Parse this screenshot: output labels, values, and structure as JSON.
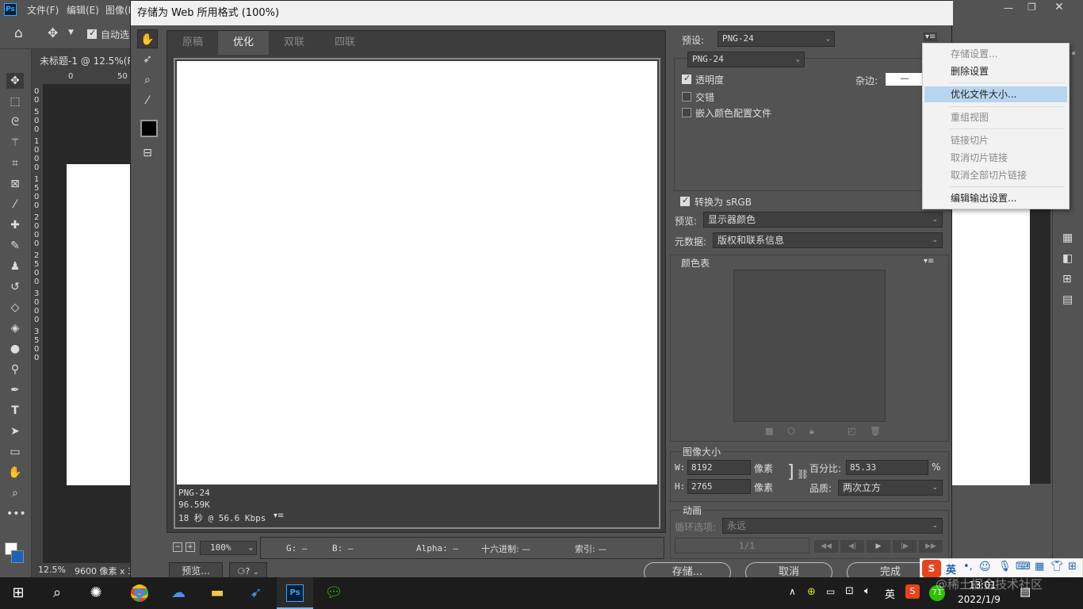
{
  "ps": {
    "menu": [
      "文件(F)",
      "编辑(E)",
      "图像(I"
    ],
    "auto_select": "自动选",
    "doc_tab": "未标题-1 @ 12.5%(R",
    "zoom": "12.5%",
    "doc_size": "9600 像素 x 3",
    "ruler_h": [
      "0",
      "50"
    ],
    "ruler_v": [
      "0",
      "0",
      "5",
      "0",
      "0",
      "1",
      "0",
      "0",
      "0",
      "1",
      "5",
      "0",
      "0",
      "2",
      "0",
      "0",
      "0",
      "2",
      "5",
      "0",
      "0",
      "3",
      "0",
      "0",
      "0",
      "3",
      "5",
      "0",
      "0"
    ]
  },
  "dialog": {
    "title": "存储为 Web 所用格式 (100%)",
    "tabs": [
      "原稿",
      "优化",
      "双联",
      "四联"
    ],
    "active_tab": "优化",
    "info": {
      "format": "PNG-24",
      "size": "96.59K",
      "time": "18 秒 @ 56.6 Kbps"
    },
    "zoom_value": "100%",
    "pixel_info": {
      "g": "G: —",
      "b": "B: —",
      "alpha": "Alpha: —",
      "hex": "十六进制: —",
      "index": "索引: —"
    },
    "preview_button": "预览...",
    "save_button": "存储...",
    "cancel_button": "取消",
    "done_button": "完成"
  },
  "settings": {
    "preset_label": "预设:",
    "preset_value": "PNG-24",
    "format_value": "PNG-24",
    "transparency": {
      "label": "透明度",
      "checked": true
    },
    "interlaced": {
      "label": "交错",
      "checked": false
    },
    "embed_profile": {
      "label": "嵌入颜色配置文件",
      "checked": false
    },
    "matte_label": "杂边:",
    "matte_value": "—",
    "convert_srgb": {
      "label": "转换为 sRGB",
      "checked": true
    },
    "preview_label": "预览:",
    "preview_value": "显示器颜色",
    "metadata_label": "元数据:",
    "metadata_value": "版权和联系信息",
    "color_table_label": "颜色表",
    "image_size_label": "图像大小",
    "width_label": "W:",
    "width_value": "8192",
    "height_label": "H:",
    "height_value": "2765",
    "unit": "像素",
    "percent_label": "百分比:",
    "percent_value": "85.33",
    "percent_unit": "%",
    "quality_label": "品质:",
    "quality_value": "两次立方",
    "animation_label": "动画",
    "loop_label": "循环选项:",
    "loop_value": "永远",
    "frame_counter": "1/1"
  },
  "menu": {
    "items": [
      {
        "label": "存储设置...",
        "disabled": true
      },
      {
        "label": "删除设置",
        "disabled": false
      },
      {
        "label": "优化文件大小...",
        "disabled": false,
        "highlighted": true
      },
      {
        "label": "重组视图",
        "disabled": true
      },
      {
        "label": "链接切片",
        "disabled": true
      },
      {
        "label": "取消切片链接",
        "disabled": true
      },
      {
        "label": "取消全部切片链接",
        "disabled": true
      },
      {
        "label": "编辑输出设置...",
        "disabled": false
      }
    ]
  },
  "taskbar": {
    "apps": [
      "windows-start",
      "search",
      "pinwheel-app",
      "chrome",
      "baidu-netdisk",
      "file-explorer",
      "feishu",
      "photoshop",
      "wechat"
    ],
    "ime": "英",
    "notification_count": "71",
    "time": "13:01",
    "date": "2022/1/9",
    "watermark": "@稀土掘金技术社区"
  },
  "colors": {
    "accent": "#b7d5ee",
    "dialog_bg": "#535353",
    "ps_blue": "#31a8ff"
  }
}
